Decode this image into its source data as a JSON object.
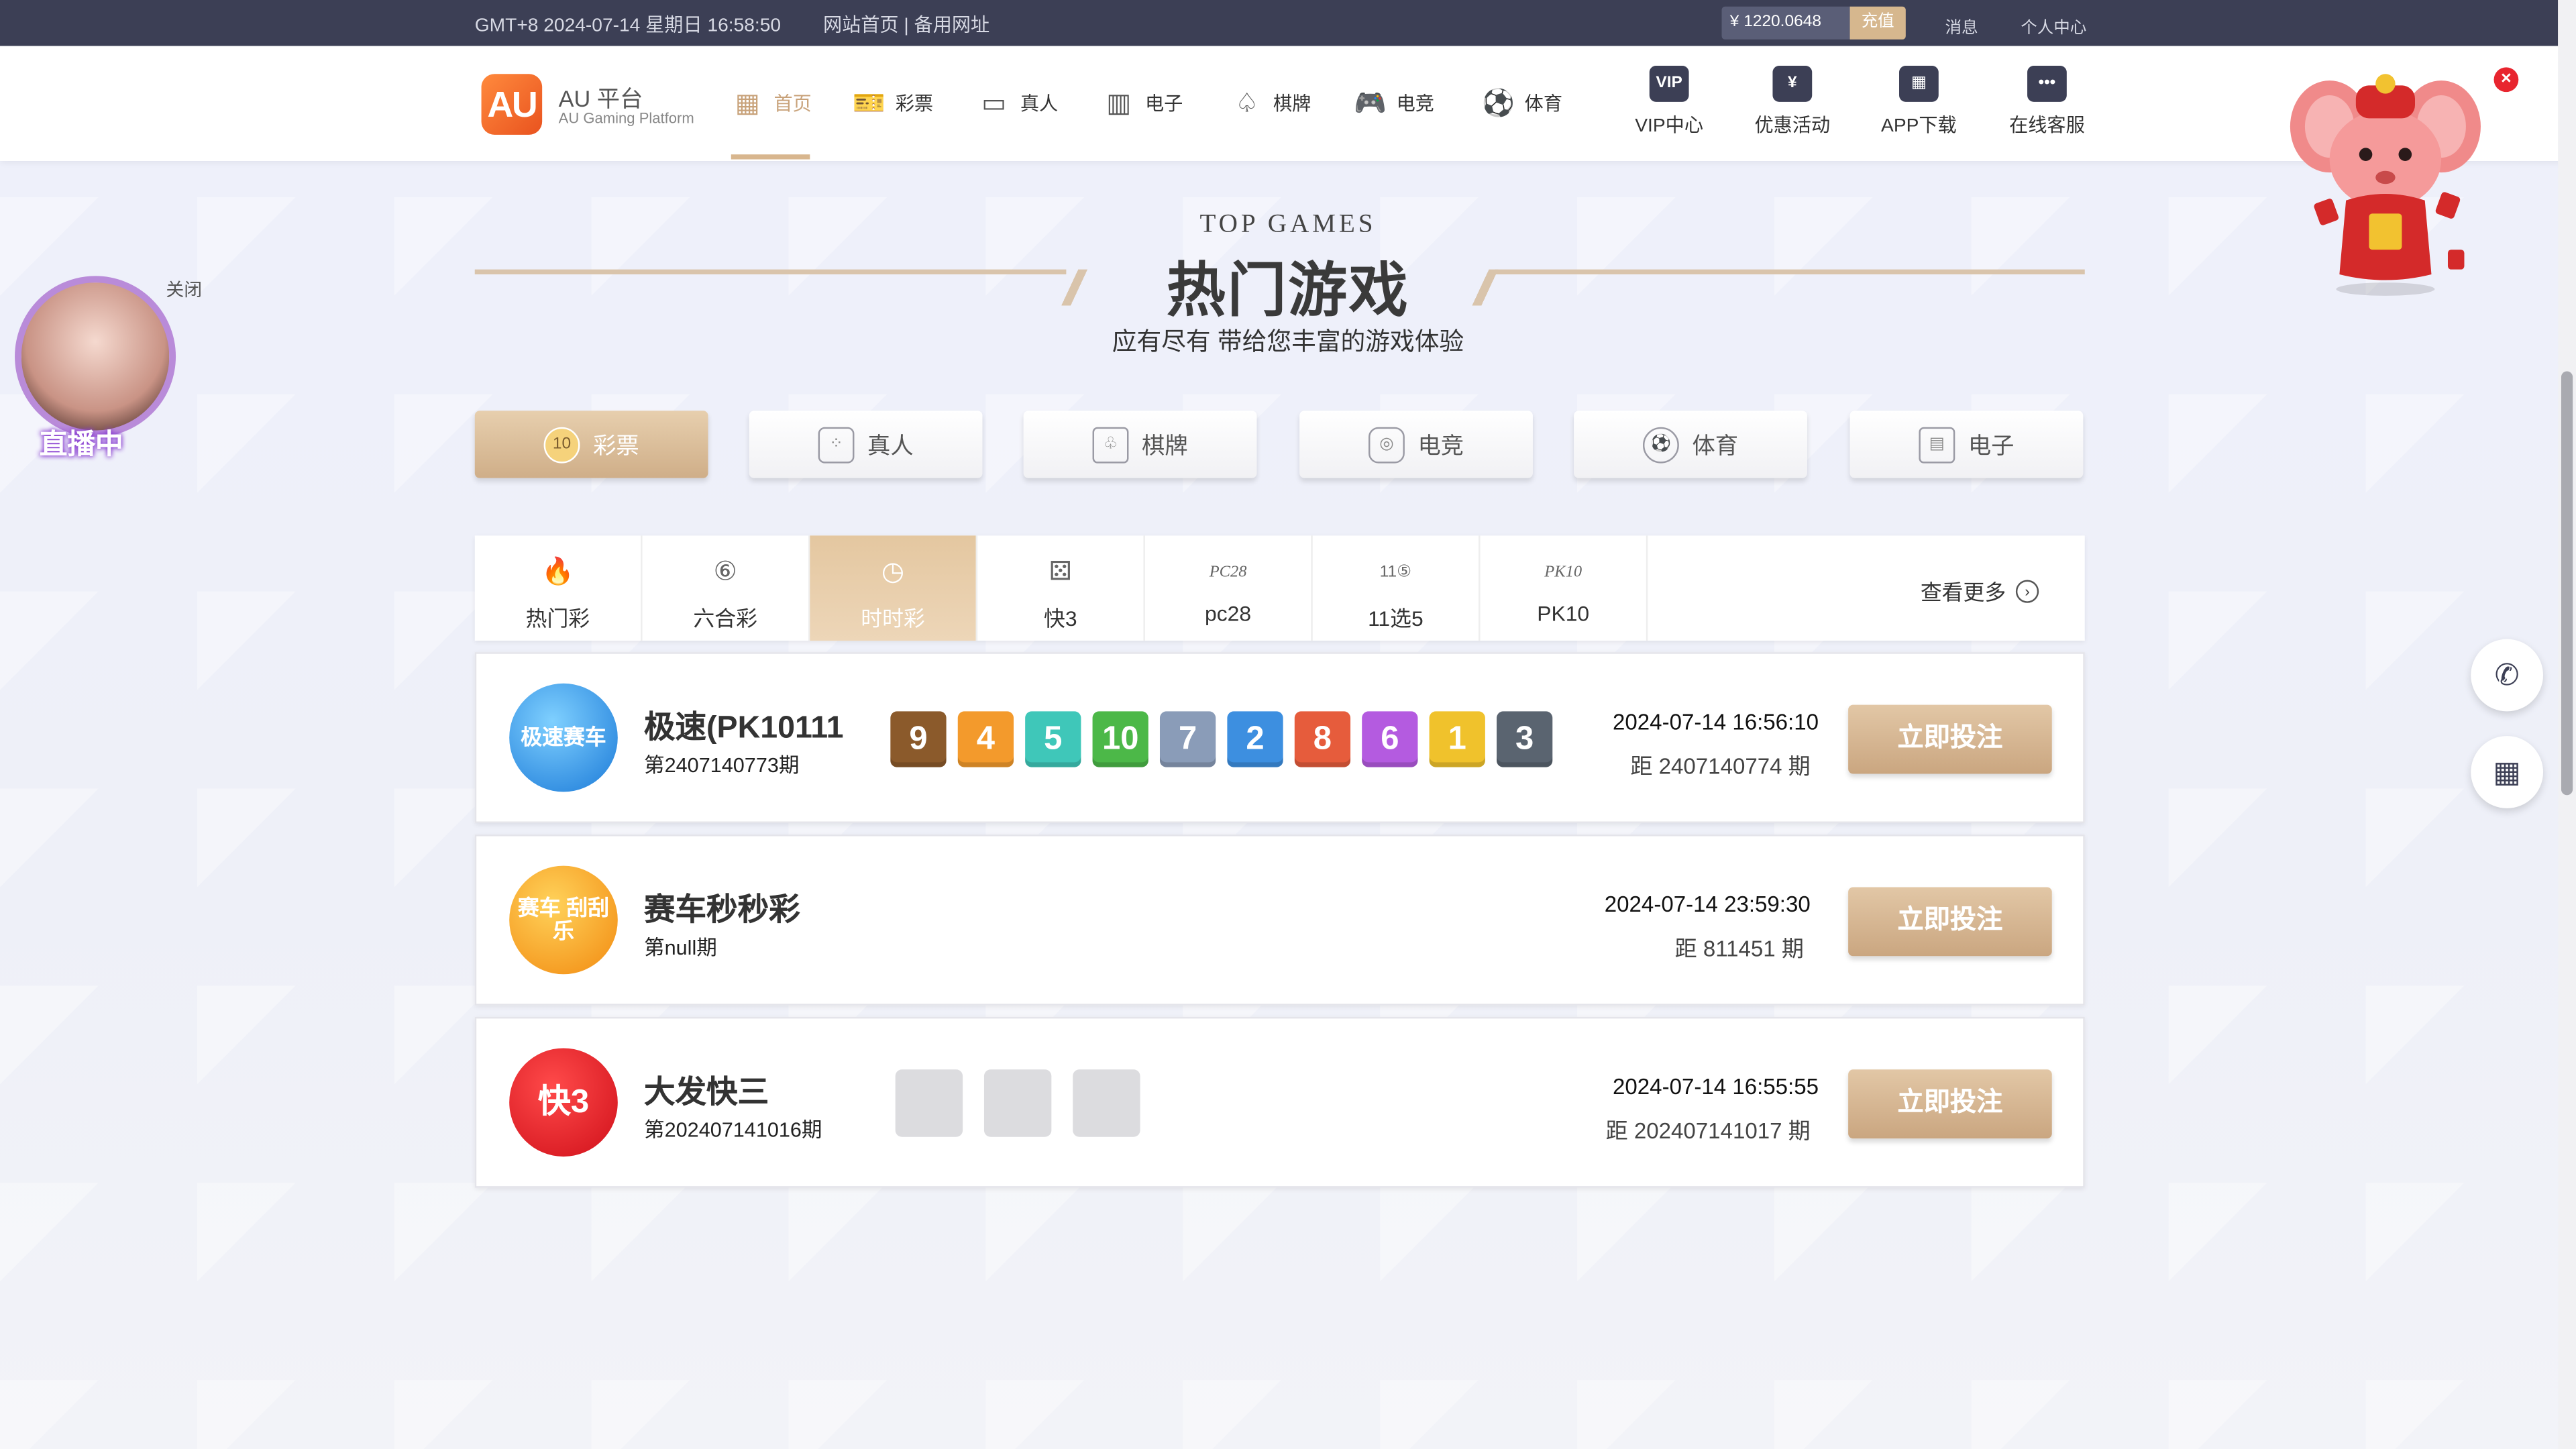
{
  "topbar": {
    "datetime": "GMT+8 2024-07-14 星期日 16:58:50",
    "links": "网站首页 | 备用网址",
    "balance": "¥ 1220.0648",
    "recharge": "充值",
    "messages": "消息",
    "profile": "个人中心"
  },
  "nav": {
    "logo_text": "AU",
    "logo_title": "AU 平台",
    "logo_subtitle": "AU Gaming Platform",
    "items": [
      {
        "label": "首页",
        "icon": "grid-icon",
        "glyph": "▦"
      },
      {
        "label": "彩票",
        "icon": "ticket-icon",
        "glyph": "🎫"
      },
      {
        "label": "真人",
        "icon": "live-camera-icon",
        "glyph": "▭"
      },
      {
        "label": "电子",
        "icon": "slot-machine-icon",
        "glyph": "▥"
      },
      {
        "label": "棋牌",
        "icon": "spade-icon",
        "glyph": "♤"
      },
      {
        "label": "电竞",
        "icon": "gamepad-icon",
        "glyph": "🎮"
      },
      {
        "label": "体育",
        "icon": "soccer-ball-icon",
        "glyph": "⚽"
      }
    ],
    "right": [
      {
        "label": "VIP中心",
        "badge": "VIP"
      },
      {
        "label": "优惠活动",
        "badge": "¥"
      },
      {
        "label": "APP下载",
        "badge": "▦"
      },
      {
        "label": "在线客服",
        "badge": "•••"
      }
    ]
  },
  "header": {
    "top_games": "TOP GAMES",
    "title": "热门游戏",
    "subtitle": "应有尽有 带给您丰富的游戏体验"
  },
  "categories": [
    {
      "label": "彩票",
      "glyph": "10"
    },
    {
      "label": "真人",
      "glyph": "⁘"
    },
    {
      "label": "棋牌",
      "glyph": "♧"
    },
    {
      "label": "电竞",
      "glyph": "◎"
    },
    {
      "label": "体育",
      "glyph": "⚽"
    },
    {
      "label": "电子",
      "glyph": "▤"
    }
  ],
  "subtabs": [
    {
      "label": "热门彩",
      "glyph": "🔥"
    },
    {
      "label": "六合彩",
      "glyph": "⑥"
    },
    {
      "label": "时时彩",
      "glyph": "◷"
    },
    {
      "label": "快3",
      "glyph": "⚄"
    },
    {
      "label": "pc28",
      "glyph": "PC28"
    },
    {
      "label": "11选5",
      "glyph": "11⑤"
    },
    {
      "label": "PK10",
      "glyph": "PK10"
    }
  ],
  "see_more": "查看更多",
  "games": [
    {
      "name": "极速(PK10111",
      "period": "第2407140773期",
      "time": "2024-07-14 16:56:10",
      "next": "距 2407140774 期",
      "bet": "立即投注",
      "logo_text": "极速赛车",
      "numbers": [
        "9",
        "4",
        "5",
        "10",
        "7",
        "2",
        "8",
        "6",
        "1",
        "3"
      ]
    },
    {
      "name": "赛车秒秒彩",
      "period": "第null期",
      "time": "2024-07-14 23:59:30",
      "next": "距 811451 期",
      "bet": "立即投注",
      "logo_text": "赛车 刮刮乐"
    },
    {
      "name": "大发快三",
      "period": "第202407141016期",
      "time": "2024-07-14 16:55:55",
      "next": "距 202407141017 期",
      "bet": "立即投注",
      "logo_text": "快3"
    }
  ],
  "ball_colors": [
    "#8b5a2b",
    "#f39a2c",
    "#3fc7b9",
    "#4cb848",
    "#8a9cb8",
    "#3d8fe0",
    "#e65c3c",
    "#b45be0",
    "#f0c22c",
    "#5a6470"
  ],
  "live": {
    "label": "直播中",
    "close": "关闭"
  },
  "colors": {
    "accent": "#d6b78e",
    "dark": "#3c3f55"
  }
}
